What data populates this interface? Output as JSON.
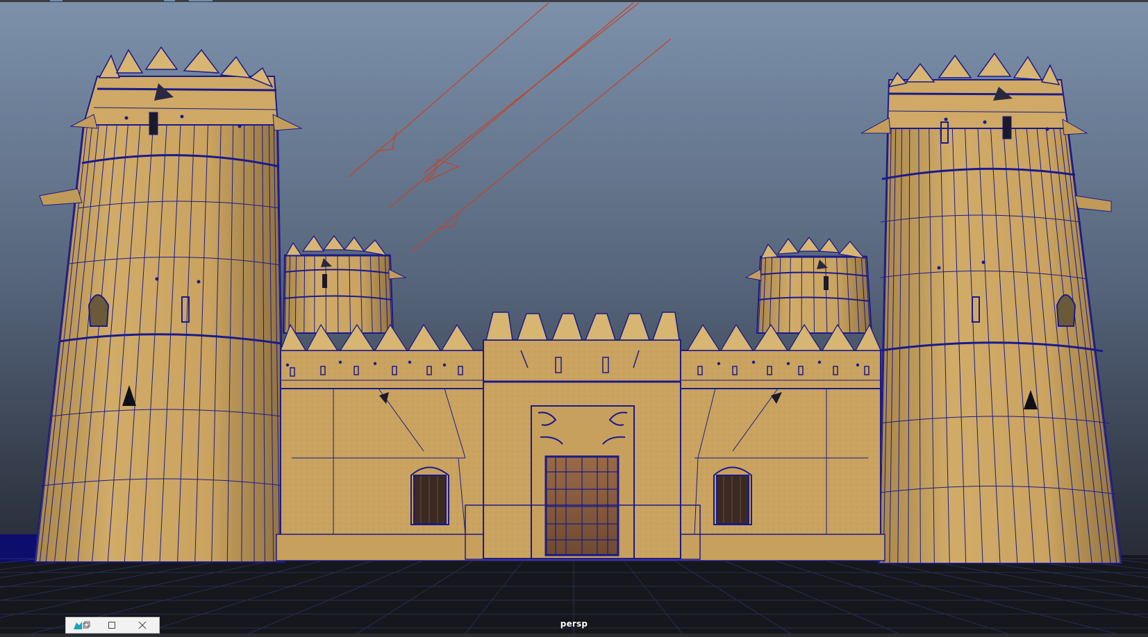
{
  "viewport": {
    "camera_label": "persp",
    "background_top": "#7b8ea8",
    "background_bottom": "#1d2026",
    "wireframe_color": "#1a1a8c",
    "sand_color": "#c9a35f",
    "light_color": "#c0452a"
  },
  "window_controls": {
    "icons": [
      "app-icon",
      "restore-icon",
      "maximize-icon",
      "close-icon"
    ]
  }
}
